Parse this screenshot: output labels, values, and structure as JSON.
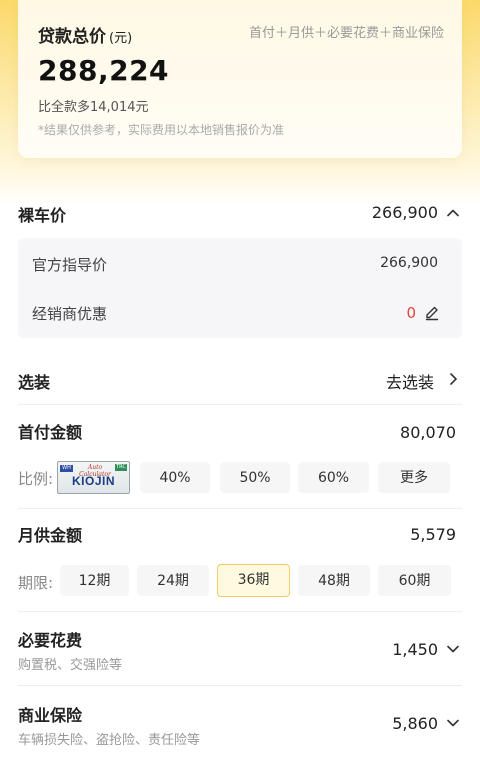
{
  "summary": {
    "title": "贷款总价",
    "unit": "(元)",
    "formula": "首付＋月供＋必要花费＋商业保险",
    "total": "288,224",
    "compare": "比全款多14,014元",
    "note": "*结果仅供参考，实际费用以本地销售报价为准"
  },
  "bare_price": {
    "label": "裸车价",
    "value": "266,900",
    "expanded": true,
    "guide_label": "官方指导价",
    "guide_value": "266,900",
    "discount_label": "经销商优惠",
    "discount_value": "0"
  },
  "options": {
    "label": "选装",
    "link": "去选装"
  },
  "down_payment": {
    "label": "首付金额",
    "value": "80,070",
    "ratio_label": "比例:",
    "plate": {
      "tag_left": "WH",
      "script": "Auto Calculator",
      "tag_right": "TRC",
      "text": "KIOJIN"
    },
    "ratios": [
      "40%",
      "50%",
      "60%",
      "更多"
    ]
  },
  "monthly": {
    "label": "月供金额",
    "value": "5,579",
    "term_label": "期限:",
    "terms": [
      "12期",
      "24期",
      "36期",
      "48期",
      "60期"
    ],
    "selected_term": "36期"
  },
  "required_fees": {
    "label": "必要花费",
    "sub": "购置税、交强险等",
    "value": "1,450"
  },
  "insurance": {
    "label": "商业保险",
    "sub": "车辆损失险、盗抢险、责任险等",
    "value": "5,860"
  },
  "colors": {
    "accent_yellow": "#fbd96a",
    "discount_red": "#e8433c",
    "selected_border": "#f0cc66"
  }
}
